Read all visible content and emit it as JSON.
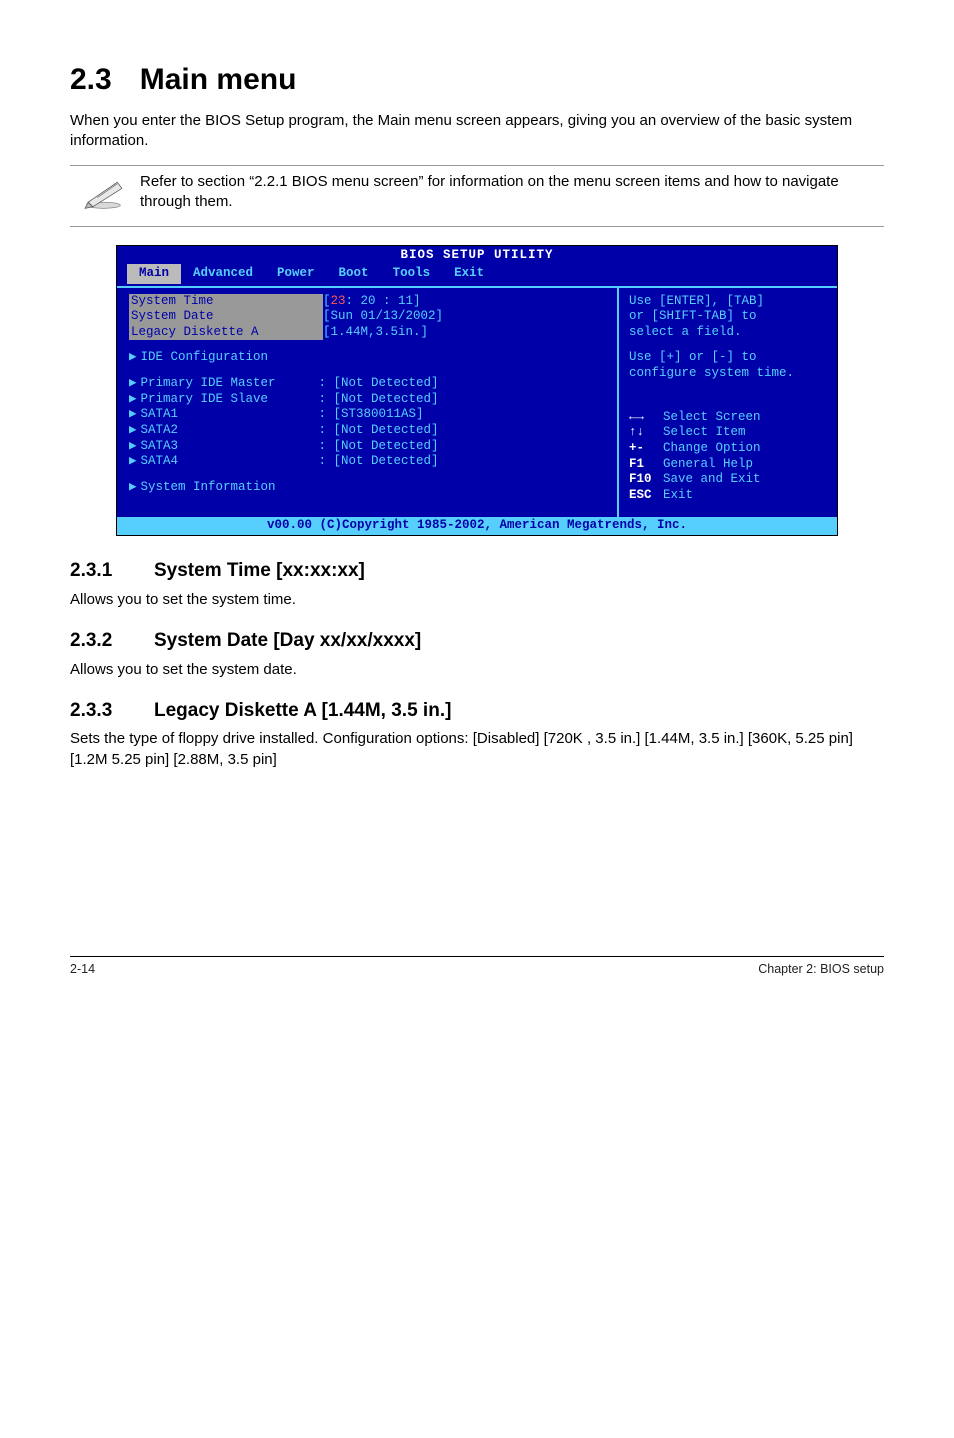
{
  "section": {
    "number": "2.3",
    "title": "Main menu",
    "intro": "When you enter the BIOS Setup program, the Main menu screen appears, giving you an overview of the basic system information.",
    "note": "Refer to section “2.2.1 BIOS menu screen” for information on the menu screen items and how to navigate through them."
  },
  "bios": {
    "title": "BIOS SETUP UTILITY",
    "tabs": [
      "Main",
      "Advanced",
      "Power",
      "Boot",
      "Tools",
      "Exit"
    ],
    "active_tab": "Main",
    "fields": {
      "system_time_label": "System Time",
      "system_time_value_prefix": "[",
      "system_time_hour": "23",
      "system_time_rest": ": 20 : 11]",
      "system_date_label": "System Date",
      "system_date_value": "[Sun 01/13/2002]",
      "legacy_label": "Legacy Diskette A",
      "legacy_value": "[1.44M,3.5in.]",
      "ide_cfg": "IDE Configuration",
      "rows": [
        {
          "label": "Primary IDE Master",
          "value": "[Not Detected]"
        },
        {
          "label": "Primary IDE Slave",
          "value": "[Not Detected]"
        },
        {
          "label": "SATA1",
          "value": "[ST380011AS]"
        },
        {
          "label": "SATA2",
          "value": "[Not Detected]"
        },
        {
          "label": "SATA3",
          "value": "[Not Detected]"
        },
        {
          "label": "SATA4",
          "value": "[Not Detected]"
        }
      ],
      "sysinfo": "System Information"
    },
    "help": {
      "line1": "Use [ENTER], [TAB]",
      "line2": "or [SHIFT-TAB] to",
      "line3": "select a field.",
      "line4": "Use [+] or [-] to",
      "line5": "configure system time."
    },
    "keys": [
      {
        "k": "←→",
        "t": "Select Screen"
      },
      {
        "k": "↑↓",
        "t": "Select Item"
      },
      {
        "k": "+-",
        "t": "Change Option"
      },
      {
        "k": "F1",
        "t": "General Help"
      },
      {
        "k": "F10",
        "t": "Save and Exit"
      },
      {
        "k": "ESC",
        "t": "Exit"
      }
    ],
    "footer": "v00.00 (C)Copyright 1985-2002, American Megatrends, Inc."
  },
  "subs": {
    "s1_num": "2.3.1",
    "s1_title": "System Time [xx:xx:xx]",
    "s1_body": "Allows you to set the system time.",
    "s2_num": "2.3.2",
    "s2_title": "System Date [Day xx/xx/xxxx]",
    "s2_body": "Allows you to set the system date.",
    "s3_num": "2.3.3",
    "s3_title": "Legacy Diskette A [1.44M, 3.5 in.]",
    "s3_body": "Sets the type of floppy drive installed. Configuration options: [Disabled] [720K , 3.5 in.] [1.44M, 3.5 in.] [360K, 5.25 pin] [1.2M 5.25 pin] [2.88M, 3.5 pin]"
  },
  "footer": {
    "left": "2-14",
    "right": "Chapter 2: BIOS setup"
  }
}
